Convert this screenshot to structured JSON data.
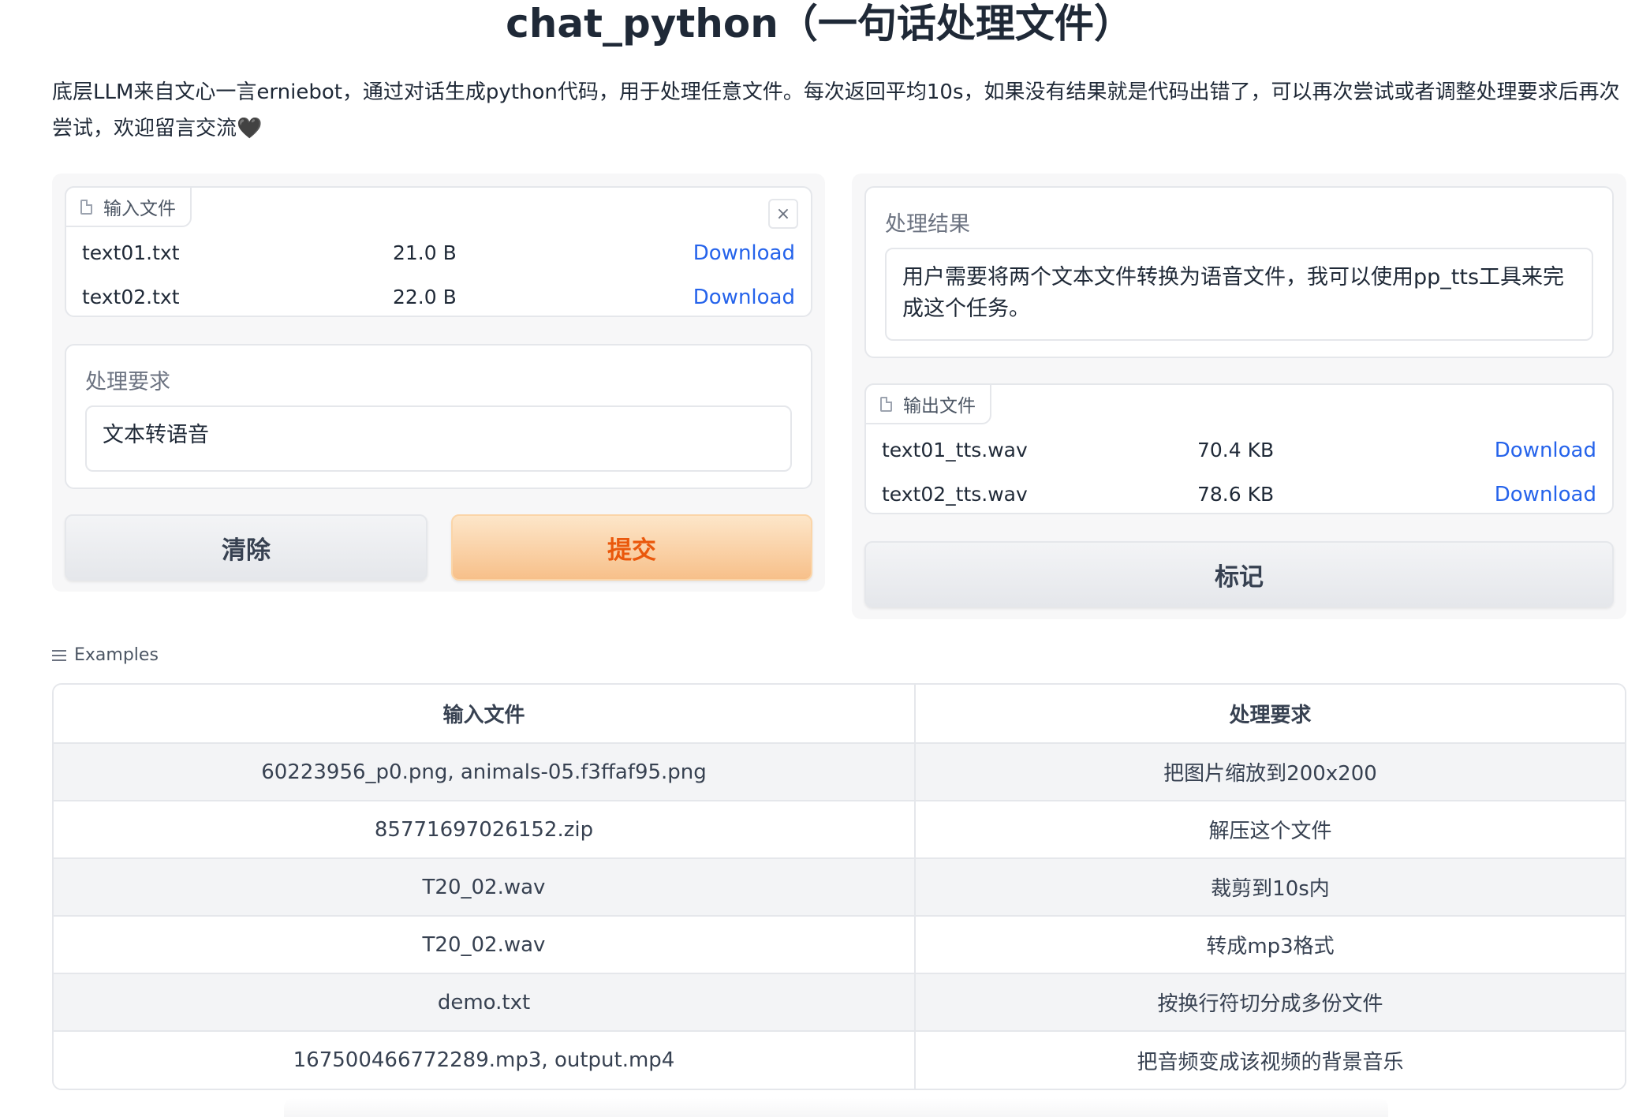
{
  "title": "chat_python（一句话处理文件）",
  "description": "底层LLM来自文心一言erniebot，通过对话生成python代码，用于处理任意文件。每次返回平均10s，如果没有结果就是代码出错了，可以再次尝试或者调整处理要求后再次尝试，欢迎留言交流🖤",
  "input_files": {
    "label": "输入文件",
    "clear_symbol": "×",
    "files": [
      {
        "name": "text01.txt",
        "size": "21.0 B",
        "link": "Download"
      },
      {
        "name": "text02.txt",
        "size": "22.0 B",
        "link": "Download"
      }
    ]
  },
  "requirement": {
    "label": "处理要求",
    "value": "文本转语音"
  },
  "buttons": {
    "clear": "清除",
    "submit": "提交",
    "flag": "标记"
  },
  "result": {
    "label": "处理结果",
    "value": "用户需要将两个文本文件转换为语音文件，我可以使用pp_tts工具来完成这个任务。"
  },
  "output_files": {
    "label": "输出文件",
    "files": [
      {
        "name": "text01_tts.wav",
        "size": "70.4 KB",
        "link": "Download"
      },
      {
        "name": "text02_tts.wav",
        "size": "78.6 KB",
        "link": "Download"
      }
    ]
  },
  "examples": {
    "label": "Examples",
    "headers": [
      "输入文件",
      "处理要求"
    ],
    "rows": [
      [
        "60223956_p0.png, animals-05.f3ffaf95.png",
        "把图片缩放到200x200"
      ],
      [
        "85771697026152.zip",
        "解压这个文件"
      ],
      [
        "T20_02.wav",
        "裁剪到10s内"
      ],
      [
        "T20_02.wav",
        "转成mp3格式"
      ],
      [
        "demo.txt",
        "按换行符切分成多份文件"
      ],
      [
        "167500466772289.mp3, output.mp4",
        "把音频变成该视频的背景音乐"
      ]
    ]
  }
}
